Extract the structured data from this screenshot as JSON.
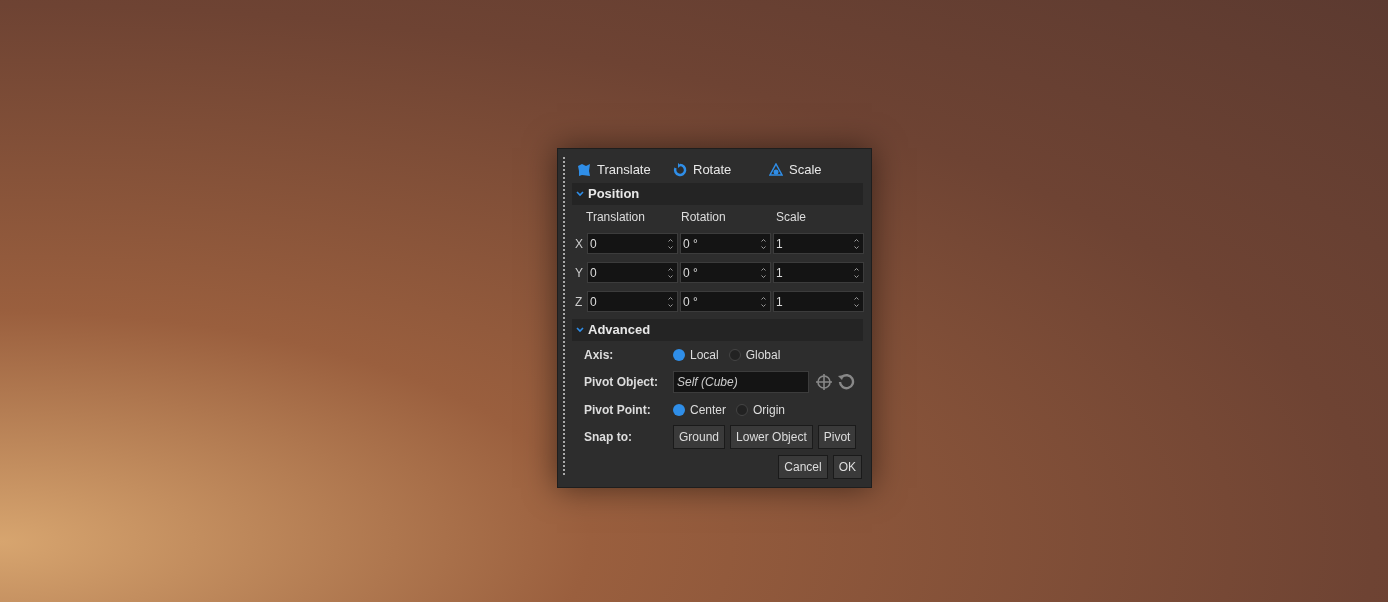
{
  "modes": [
    {
      "label": "Translate",
      "kind": "translate"
    },
    {
      "label": "Rotate",
      "kind": "rotate"
    },
    {
      "label": "Scale",
      "kind": "scale"
    }
  ],
  "position": {
    "title": "Position",
    "expanded": true,
    "columns": [
      "Translation",
      "Rotation",
      "Scale"
    ],
    "rows": [
      {
        "axis": "X",
        "values": [
          "0",
          "0 °",
          "1"
        ]
      },
      {
        "axis": "Y",
        "values": [
          "0",
          "0 °",
          "1"
        ]
      },
      {
        "axis": "Z",
        "values": [
          "0",
          "0 °",
          "1"
        ]
      }
    ]
  },
  "advanced": {
    "title": "Advanced",
    "expanded": true,
    "axis": {
      "label": "Axis:",
      "options": [
        {
          "label": "Local",
          "selected": true
        },
        {
          "label": "Global",
          "selected": false
        }
      ]
    },
    "pivot_object": {
      "label": "Pivot Object:",
      "value": "Self (Cube)"
    },
    "pivot_point": {
      "label": "Pivot Point:",
      "options": [
        {
          "label": "Center",
          "selected": true
        },
        {
          "label": "Origin",
          "selected": false
        }
      ]
    },
    "snap": {
      "label": "Snap to:",
      "buttons": [
        "Ground",
        "Lower Object",
        "Pivot"
      ]
    }
  },
  "buttons": [
    "Cancel",
    "OK"
  ]
}
